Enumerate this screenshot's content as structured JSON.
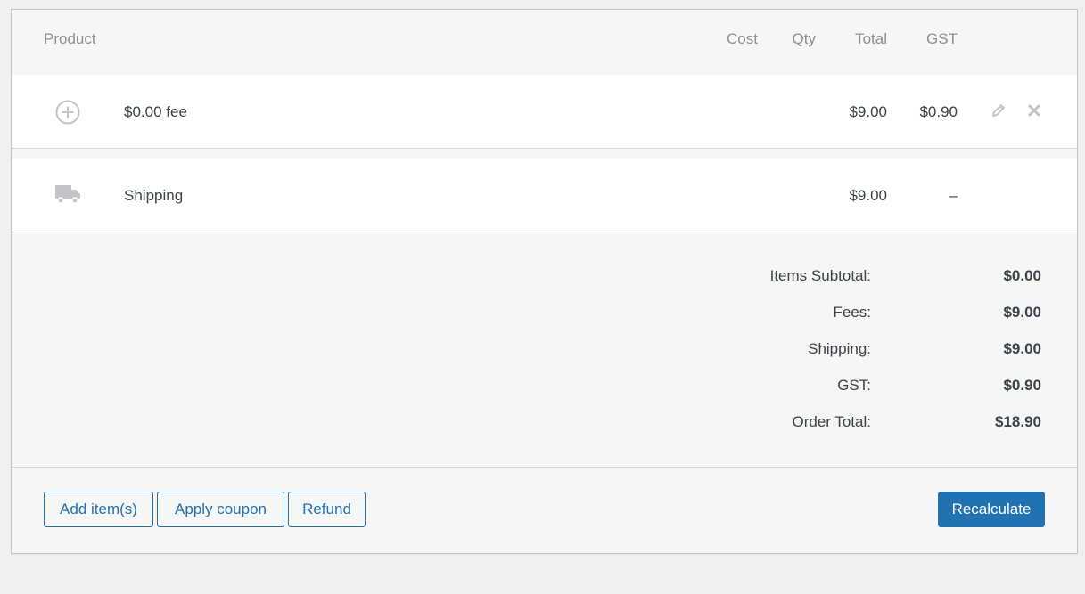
{
  "table": {
    "headers": {
      "product": "Product",
      "cost": "Cost",
      "qty": "Qty",
      "total": "Total",
      "gst": "GST"
    },
    "fee_row": {
      "icon": "plus-circle-icon",
      "name": "$0.00 fee",
      "total": "$9.00",
      "gst": "$0.90",
      "edit_icon": "pencil-icon",
      "delete_icon": "close-icon"
    },
    "shipping_row": {
      "icon": "truck-icon",
      "name": "Shipping",
      "total": "$9.00",
      "gst": "–"
    }
  },
  "totals": {
    "items_subtotal_label": "Items Subtotal:",
    "items_subtotal_value": "$0.00",
    "fees_label": "Fees:",
    "fees_value": "$9.00",
    "shipping_label": "Shipping:",
    "shipping_value": "$9.00",
    "gst_label": "GST:",
    "gst_value": "$0.90",
    "order_total_label": "Order Total:",
    "order_total_value": "$18.90"
  },
  "actions": {
    "add_items": "Add item(s)",
    "apply_coupon": "Apply coupon",
    "refund": "Refund",
    "recalculate": "Recalculate"
  },
  "colors": {
    "accent": "#2271b1",
    "panel_bg": "#f6f6f6",
    "row_bg": "#ffffff",
    "page_bg": "#f0f0f1"
  }
}
